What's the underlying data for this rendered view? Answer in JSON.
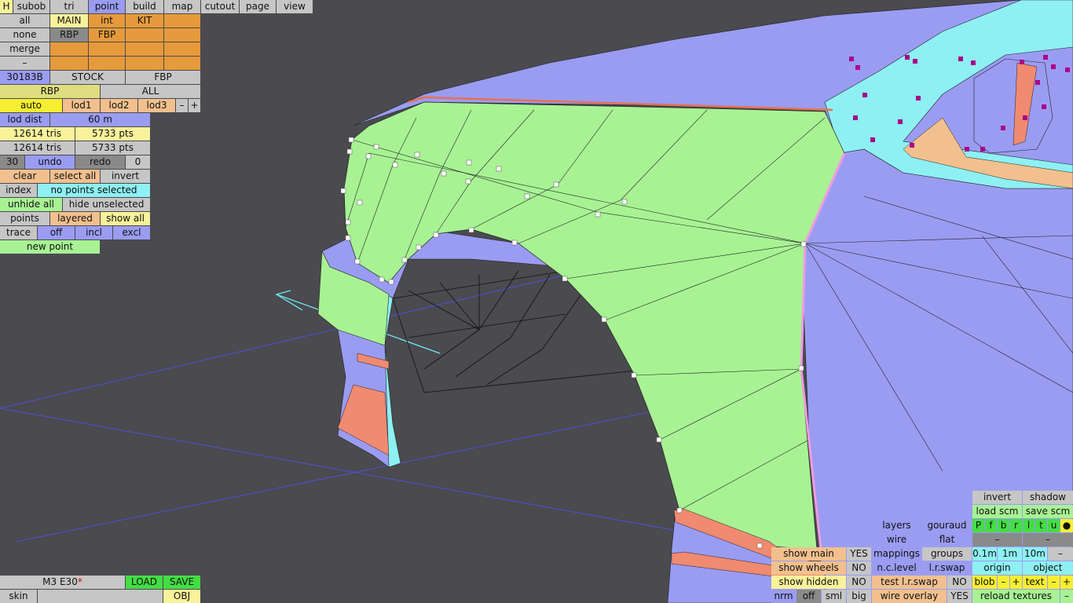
{
  "top_menu": {
    "h": "H",
    "subob": "subob",
    "tri": "tri",
    "point": "point",
    "build": "build",
    "map": "map",
    "cutout": "cutout",
    "page": "page",
    "view": "view"
  },
  "left_panel": {
    "all": "all",
    "main": "MAIN",
    "int": "int",
    "kit": "KIT",
    "none": "none",
    "rbp": "RBP",
    "fbp": "FBP",
    "merge": "merge",
    "dash": "–",
    "id": "30183B",
    "stock": "STOCK",
    "fbp2": "FBP",
    "rbp2": "RBP",
    "all2": "ALL",
    "auto": "auto",
    "lod1": "lod1",
    "lod2": "lod2",
    "lod3": "lod3",
    "minus": "–",
    "plus": "+",
    "lod_dist_label": "lod dist",
    "lod_dist_value": "60 m",
    "tris1": "12614 tris",
    "pts1": "5733 pts",
    "tris2": "12614 tris",
    "pts2": "5733 pts",
    "undo_count": "30",
    "undo": "undo",
    "redo": "redo",
    "redo_count": "0",
    "clear": "clear",
    "select_all": "select all",
    "invert": "invert",
    "index": "index",
    "selection_status": "no points selected",
    "unhide_all": "unhide all",
    "hide_unselected": "hide unselected",
    "points": "points",
    "layered": "layered",
    "show_all": "show all",
    "trace": "trace",
    "off": "off",
    "incl": "incl",
    "excl": "excl",
    "new_point": "new point"
  },
  "bottom_left": {
    "car_name": "M3 E30",
    "modified_mark": "*",
    "load": "LOAD",
    "save": "SAVE",
    "skin": "skin",
    "obj": "OBJ"
  },
  "bottom_right": {
    "show_main": "show main",
    "show_main_val": "YES",
    "show_wheels": "show wheels",
    "show_wheels_val": "NO",
    "show_hidden": "show hidden",
    "show_hidden_val": "NO",
    "nrm": "nrm",
    "off": "off",
    "sml": "sml",
    "big": "big",
    "layers": "layers",
    "gouraud": "gouraud",
    "wire": "wire",
    "flat": "flat",
    "mappings": "mappings",
    "groups": "groups",
    "nc_level": "n.c.level",
    "lr_swap": "l.r.swap",
    "test_lr_swap": "test l.r.swap",
    "test_lr_swap_val": "NO",
    "wire_overlay": "wire overlay",
    "wire_overlay_val": "YES",
    "invert": "invert",
    "shadow": "shadow",
    "load_scm": "load scm",
    "save_scm": "save scm",
    "view_letters": [
      "P",
      "f",
      "b",
      "r",
      "l",
      "t",
      "u"
    ],
    "view_dot": "●",
    "dash1": "–",
    "dash2": "–",
    "step1": "0.1m",
    "step2": "1m",
    "step3": "10m",
    "step_minus": "–",
    "origin": "origin",
    "object": "object",
    "blob": "blob",
    "text": "text",
    "minus": "–",
    "plus": "+",
    "reload_textures": "reload textures",
    "reload_minus": "–"
  },
  "colors": {
    "background": "#4a4a4f",
    "panel_green": "#a8f294",
    "panel_blue": "#9a9cf2",
    "mesh_cyan": "#8ef0f2",
    "mesh_salmon": "#f08a70",
    "mesh_magenta": "#aa0088"
  }
}
